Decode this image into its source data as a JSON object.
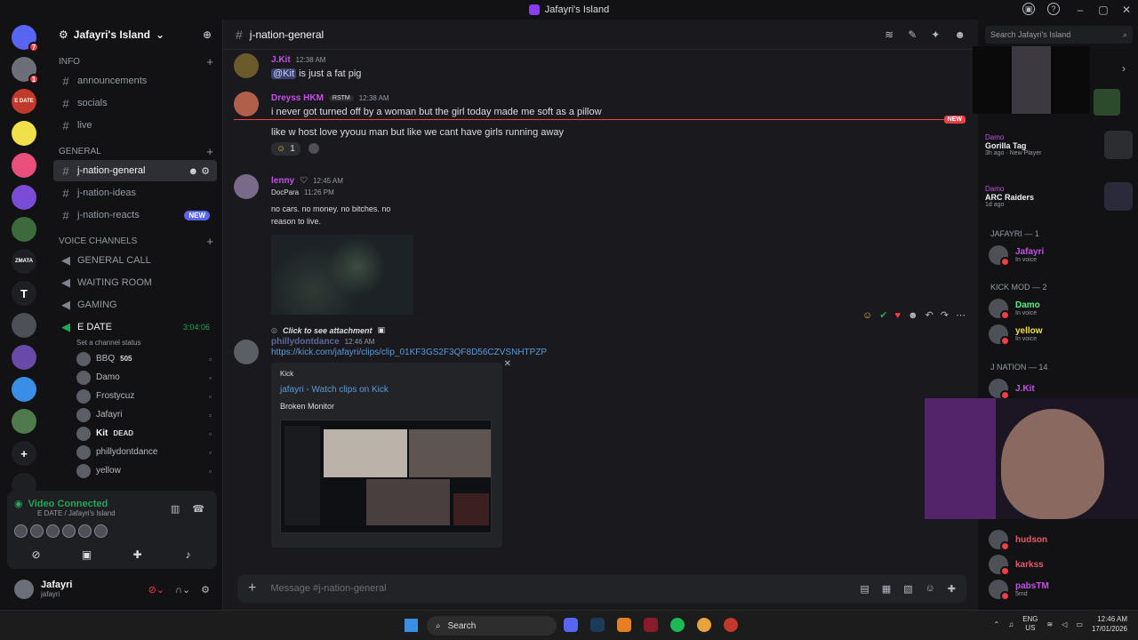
{
  "window": {
    "title": "Jafayri's Island"
  },
  "rail": {
    "servers": [
      {
        "label": "",
        "badge": "7",
        "color": "#5865f2"
      },
      {
        "label": "",
        "badge": "1",
        "color": "#6d6f78"
      },
      {
        "label": "E DATE",
        "badge": "",
        "color": "#c0392b"
      },
      {
        "label": "",
        "badge": "",
        "color": "#f0e14a"
      },
      {
        "label": "",
        "badge": "",
        "color": "#e84f7a"
      },
      {
        "label": "",
        "badge": "",
        "color": "#7b4dd6"
      },
      {
        "label": "",
        "badge": "",
        "color": "#3c6a3c"
      },
      {
        "label": "ZMATA",
        "badge": "",
        "color": "#1e1f22"
      },
      {
        "label": "T",
        "badge": "",
        "color": "#1e1f22"
      },
      {
        "label": "",
        "badge": "",
        "color": "#4e5058"
      },
      {
        "label": "",
        "badge": "",
        "color": "#6a4aa8"
      },
      {
        "label": "",
        "badge": "",
        "color": "#3a8ee6"
      },
      {
        "label": "",
        "badge": "",
        "color": "#4e7a4e"
      },
      {
        "label": "+",
        "badge": "",
        "color": "#1e1f22"
      },
      {
        "label": "",
        "badge": "",
        "color": "#1e1f22"
      }
    ]
  },
  "sidebar": {
    "guild_name": "Jafayri's Island",
    "cat_info": "INFO",
    "info_channels": [
      "announcements",
      "socials",
      "live"
    ],
    "cat_general": "GENERAL",
    "general_channels": [
      "j-nation-general",
      "j-nation-ideas",
      "j-nation-reacts"
    ],
    "new_label": "NEW",
    "cat_voice": "VOICE CHANNELS",
    "voice_channels": [
      "GENERAL CALL",
      "WAITING ROOM",
      "GAMING"
    ],
    "live_channel": "E DATE",
    "live_time": "3:04:06",
    "channel_status": "Set a channel status",
    "voice_users": [
      {
        "name": "BBQ",
        "tag": "505"
      },
      {
        "name": "Damo",
        "tag": ""
      },
      {
        "name": "Frostycuz",
        "tag": ""
      },
      {
        "name": "Jafayri",
        "tag": ""
      },
      {
        "name": "Kit",
        "tag": "DEAD"
      },
      {
        "name": "phillydontdance",
        "tag": ""
      },
      {
        "name": "yellow",
        "tag": ""
      }
    ]
  },
  "voice_panel": {
    "status": "Video Connected",
    "location": "E DATE / Jafayri's Island"
  },
  "user": {
    "display_name": "Jafayri",
    "username": "jafayri"
  },
  "chat": {
    "channel": "j-nation-general",
    "messages": [
      {
        "author": "J.Kit",
        "time": "12:38 AM",
        "mention": "@Kit",
        "text": " is just a fat pig"
      },
      {
        "author": "Dreyss HKM",
        "tag": "RSTM",
        "time": "12:38 AM",
        "text": "i never got turned off by a woman but the girl today made me soft as a pillow",
        "text2": "like w host love yyouu man but like we cant have girls running away",
        "reaction_count": "1"
      },
      {
        "author": "lenny",
        "time": "12:45 AM",
        "quote_author": "DocPara",
        "quote_time": "11:26 PM",
        "text": "no cars. no money. no bitches. no reason to live."
      },
      {
        "author": "phillydontdance",
        "time": "12:46 AM",
        "reply_label": "Click to see attachment",
        "link": "https://kick.com/jafayri/clips/clip_01KF3GS2F3QF8D56CZVSNHTPZP",
        "embed_provider": "Kick",
        "embed_title": "jafayri - Watch clips on Kick",
        "embed_desc": "Broken Monitor"
      }
    ],
    "new_label": "NEW",
    "placeholder": "Message #j-nation-general"
  },
  "members": {
    "search_placeholder": "Search Jafayri's Island",
    "activities": [
      {
        "who": "Damo",
        "game": "Gorilla Tag",
        "sub": "3h ago · New Player"
      },
      {
        "who": "Damo",
        "game": "ARC Raiders",
        "sub": "1d ago"
      }
    ],
    "cat1": "Jafayri — 1",
    "cat2": "KICK MOD — 2",
    "cat3": "J NATION — 14",
    "list1": [
      {
        "name": "Jafayri",
        "status": "In voice"
      }
    ],
    "list2": [
      {
        "name": "Damo",
        "status": "In voice"
      },
      {
        "name": "yellow",
        "status": "In voice"
      }
    ],
    "list3": [
      {
        "name": "J.Kit",
        "status": ""
      }
    ],
    "list4": [
      {
        "name": "hudson",
        "status": ""
      },
      {
        "name": "karkss",
        "status": ""
      },
      {
        "name": "pabsTM",
        "status": "5md"
      }
    ]
  },
  "taskbar": {
    "search": "Search",
    "lang": "ENG",
    "region": "US",
    "time": "12:46 AM",
    "date": "17/01/2026"
  }
}
